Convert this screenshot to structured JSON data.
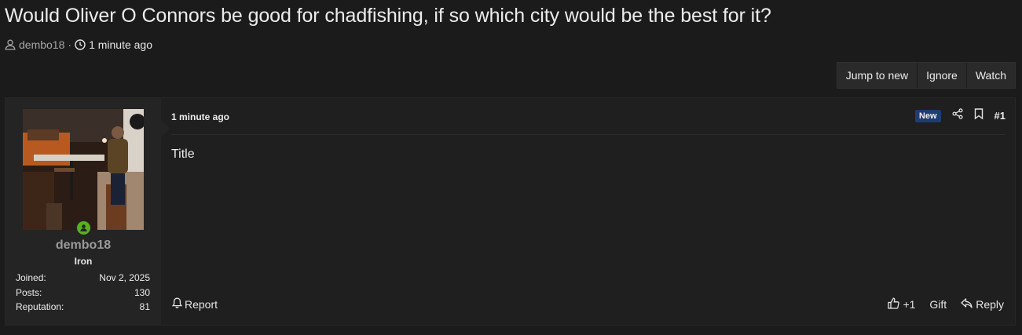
{
  "thread": {
    "title": "Would Oliver O Connors be good for chadfishing, if so which city would be the best for it?",
    "author": "dembo18",
    "separator": "·",
    "time": "1 minute ago"
  },
  "thread_actions": {
    "jump_to_new": "Jump to new",
    "ignore": "Ignore",
    "watch": "Watch"
  },
  "post": {
    "user": {
      "username": "dembo18",
      "rank": "Iron",
      "online": true,
      "stats": [
        {
          "label": "Joined:",
          "value": "Nov 2, 2025"
        },
        {
          "label": "Posts:",
          "value": "130"
        },
        {
          "label": "Reputation:",
          "value": "81"
        }
      ]
    },
    "time": "1 minute ago",
    "badge": "New",
    "number": "#1",
    "body": "Title",
    "footer": {
      "report": "Report",
      "like": "+1",
      "gift": "Gift",
      "reply": "Reply"
    }
  },
  "icons": {
    "user": "user-icon",
    "clock": "clock-icon",
    "share": "share-icon",
    "bookmark": "bookmark-icon",
    "bell": "bell-icon",
    "thumbs_up": "thumbs-up-icon",
    "reply": "reply-icon"
  },
  "colors": {
    "background": "#1b1b1b",
    "panel": "#1f1f1f",
    "user_panel": "#242424",
    "badge_new": "#1f3c73",
    "online": "#5ab11e"
  }
}
